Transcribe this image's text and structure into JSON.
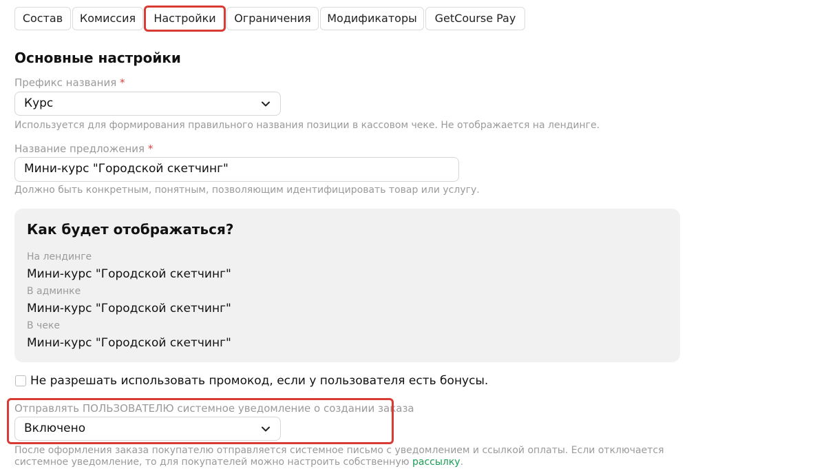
{
  "tabs": [
    {
      "label": "Состав",
      "active": false
    },
    {
      "label": "Комиссия",
      "active": false
    },
    {
      "label": "Настройки",
      "active": true
    },
    {
      "label": "Ограничения",
      "active": false
    },
    {
      "label": "Модификаторы",
      "active": false
    },
    {
      "label": "GetCourse Pay",
      "active": false
    }
  ],
  "main": {
    "section_title": "Основные настройки",
    "prefix": {
      "label": "Префикс названия",
      "required_mark": "*",
      "value": "Курс",
      "hint": "Используется для формирования правильного названия позиции в кассовом чеке. Не отображается на лендинге."
    },
    "offer_name": {
      "label": "Название предложения",
      "required_mark": "*",
      "value": "Мини-курс \"Городской скетчинг\"",
      "hint": "Должно быть конкретным, понятным, позволяющим идентифицировать товар или услугу."
    },
    "preview": {
      "title": "Как будет отображаться?",
      "rows": [
        {
          "label": "На лендинге",
          "value": "Мини-курс \"Городской скетчинг\""
        },
        {
          "label": "В админке",
          "value": "Мини-курс \"Городской скетчинг\""
        },
        {
          "label": "В чеке",
          "value": "Мини-курс \"Городской скетчинг\""
        }
      ]
    },
    "promo_checkbox": {
      "label": "Не разрешать использовать промокод, если у пользователя есть бонусы.",
      "checked": false
    },
    "notify": {
      "label": "Отправлять ПОЛЬЗОВАТЕЛЮ системное уведомление о создании заказа",
      "value": "Включено",
      "desc_line1": "После оформления заказа покупателю отправляется системное письмо с уведомлением и ссылкой оплаты. Если отключается",
      "desc_line2_before": "системное уведомление, то для покупателей можно настроить собственную",
      "desc_link": "рассылку",
      "desc_line2_after": "."
    }
  },
  "colors": {
    "highlight": "#d83a34",
    "link": "#1a9e54",
    "required": "#e0453f",
    "card_bg": "#f1f1f1"
  },
  "icons": {
    "select_chevron": "chevron-down-icon"
  }
}
